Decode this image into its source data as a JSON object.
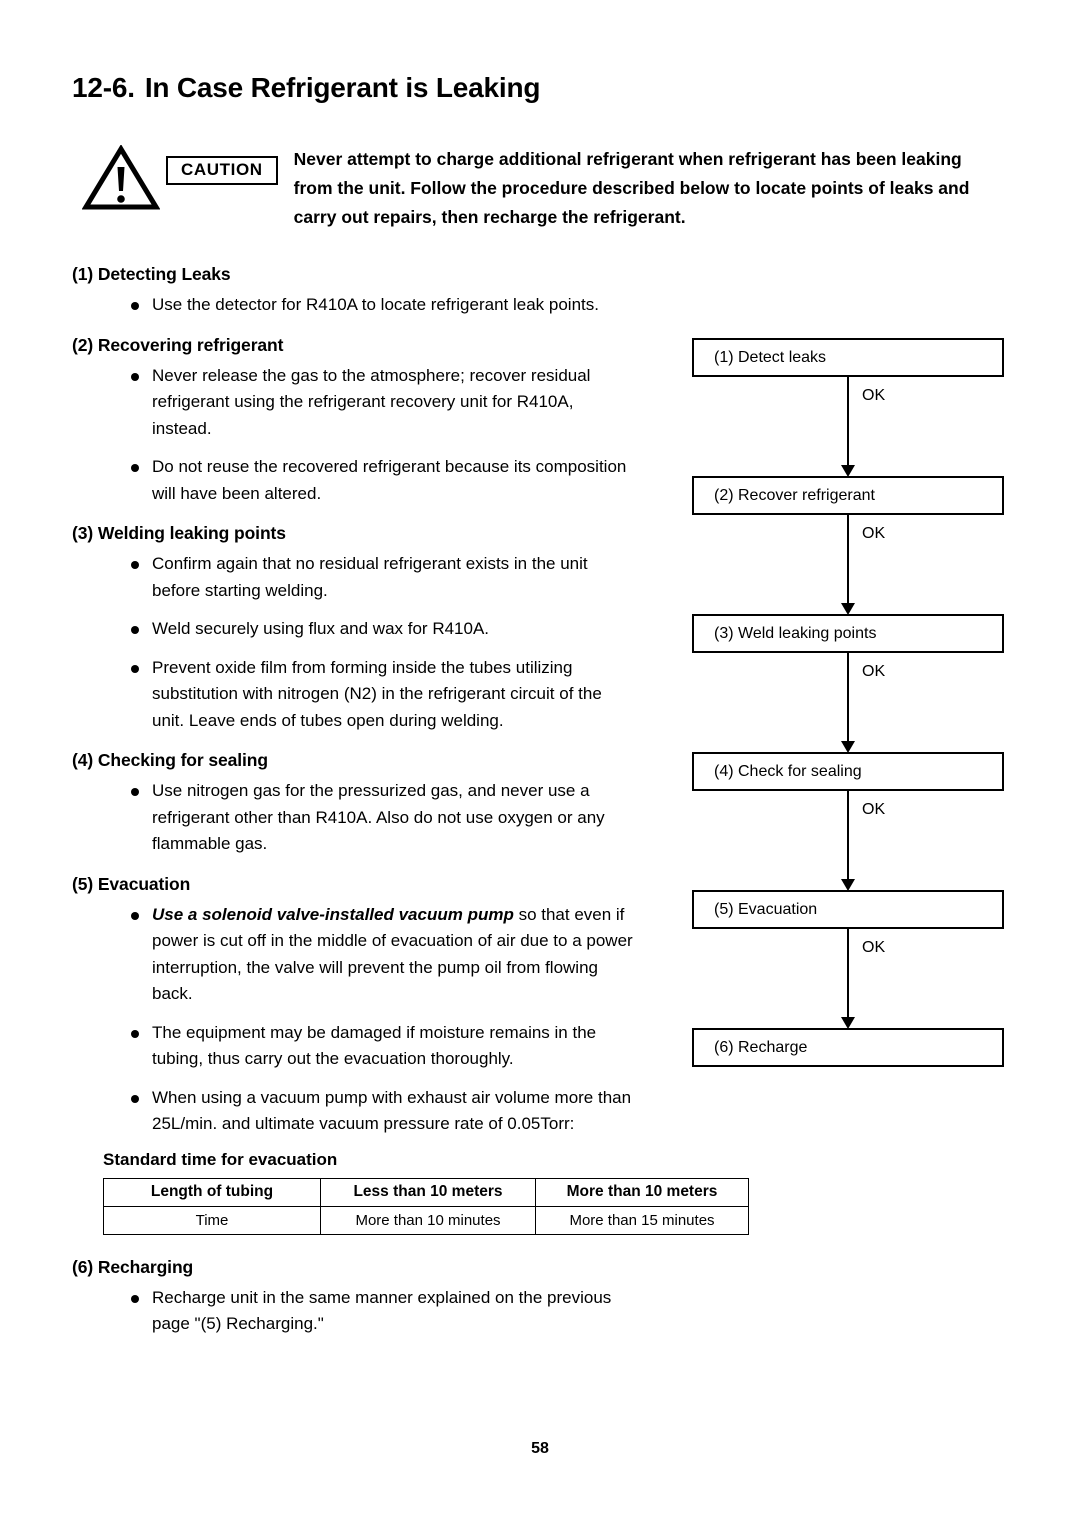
{
  "title": {
    "number": "12-6.",
    "text": "In Case Refrigerant is Leaking"
  },
  "caution": {
    "icon": "warning-triangle-icon",
    "badge": "CAUTION",
    "text": "Never attempt to charge additional refrigerant when refrigerant has been leaking from the unit. Follow the procedure described below to locate points of leaks and carry out repairs, then recharge the refrigerant."
  },
  "sections": [
    {
      "heading": "(1) Detecting Leaks",
      "bullets": [
        {
          "text": "Use the detector for R410A to locate refrigerant leak points."
        }
      ]
    },
    {
      "heading": "(2) Recovering refrigerant",
      "bullets": [
        {
          "text": "Never release the gas to the atmosphere; recover residual refrigerant using the refrigerant recovery unit for R410A, instead."
        },
        {
          "text": "Do not reuse the recovered refrigerant because its composition will have been altered."
        }
      ]
    },
    {
      "heading": "(3) Welding leaking points",
      "bullets": [
        {
          "text": "Confirm again that no residual refrigerant exists in the unit before starting welding."
        },
        {
          "text": "Weld securely using flux and wax for R410A."
        },
        {
          "text": "Prevent oxide film from forming inside the tubes utilizing substitution with nitrogen (N2) in the refrigerant circuit of the unit. Leave ends of tubes open during welding."
        }
      ]
    },
    {
      "heading": "(4) Checking for sealing",
      "bullets": [
        {
          "text": "Use nitrogen gas for the pressurized gas, and never use a refrigerant other than R410A. Also do not use oxygen or any flammable gas."
        }
      ]
    },
    {
      "heading": "(5) Evacuation",
      "bullets": [
        {
          "emphasis": "Use a solenoid valve-installed vacuum pump",
          "text": " so that even if power is cut off in the middle of evacuation of air due to a power interruption, the valve will prevent the pump oil from flowing back."
        },
        {
          "text": "The equipment may be damaged if moisture remains in the tubing, thus carry out the evacuation thoroughly."
        },
        {
          "text": "When using a vacuum pump with exhaust air volume more than 25L/min. and ultimate vacuum pressure rate of 0.05Torr:"
        }
      ]
    }
  ],
  "evac_table": {
    "caption": "Standard time for evacuation",
    "header": [
      "Length of tubing",
      "Less than 10 meters",
      "More than 10 meters"
    ],
    "rows": [
      [
        "Time",
        "More than 10 minutes",
        "More than 15 minutes"
      ]
    ]
  },
  "section_recharging": {
    "heading": "(6) Recharging",
    "bullets": [
      {
        "text": "Recharge unit in the same manner explained on the previous page \"(5) Recharging.\""
      }
    ]
  },
  "flowchart": {
    "steps": [
      {
        "label": "(1) Detect leaks",
        "link": "OK"
      },
      {
        "label": "(2) Recover refrigerant",
        "link": "OK"
      },
      {
        "label": "(3) Weld leaking points",
        "link": "OK"
      },
      {
        "label": "(4) Check for sealing",
        "link": "OK"
      },
      {
        "label": "(5) Evacuation",
        "link": "OK"
      },
      {
        "label": "(6) Recharge",
        "link": ""
      }
    ]
  },
  "footer": {
    "page_number": "58"
  }
}
